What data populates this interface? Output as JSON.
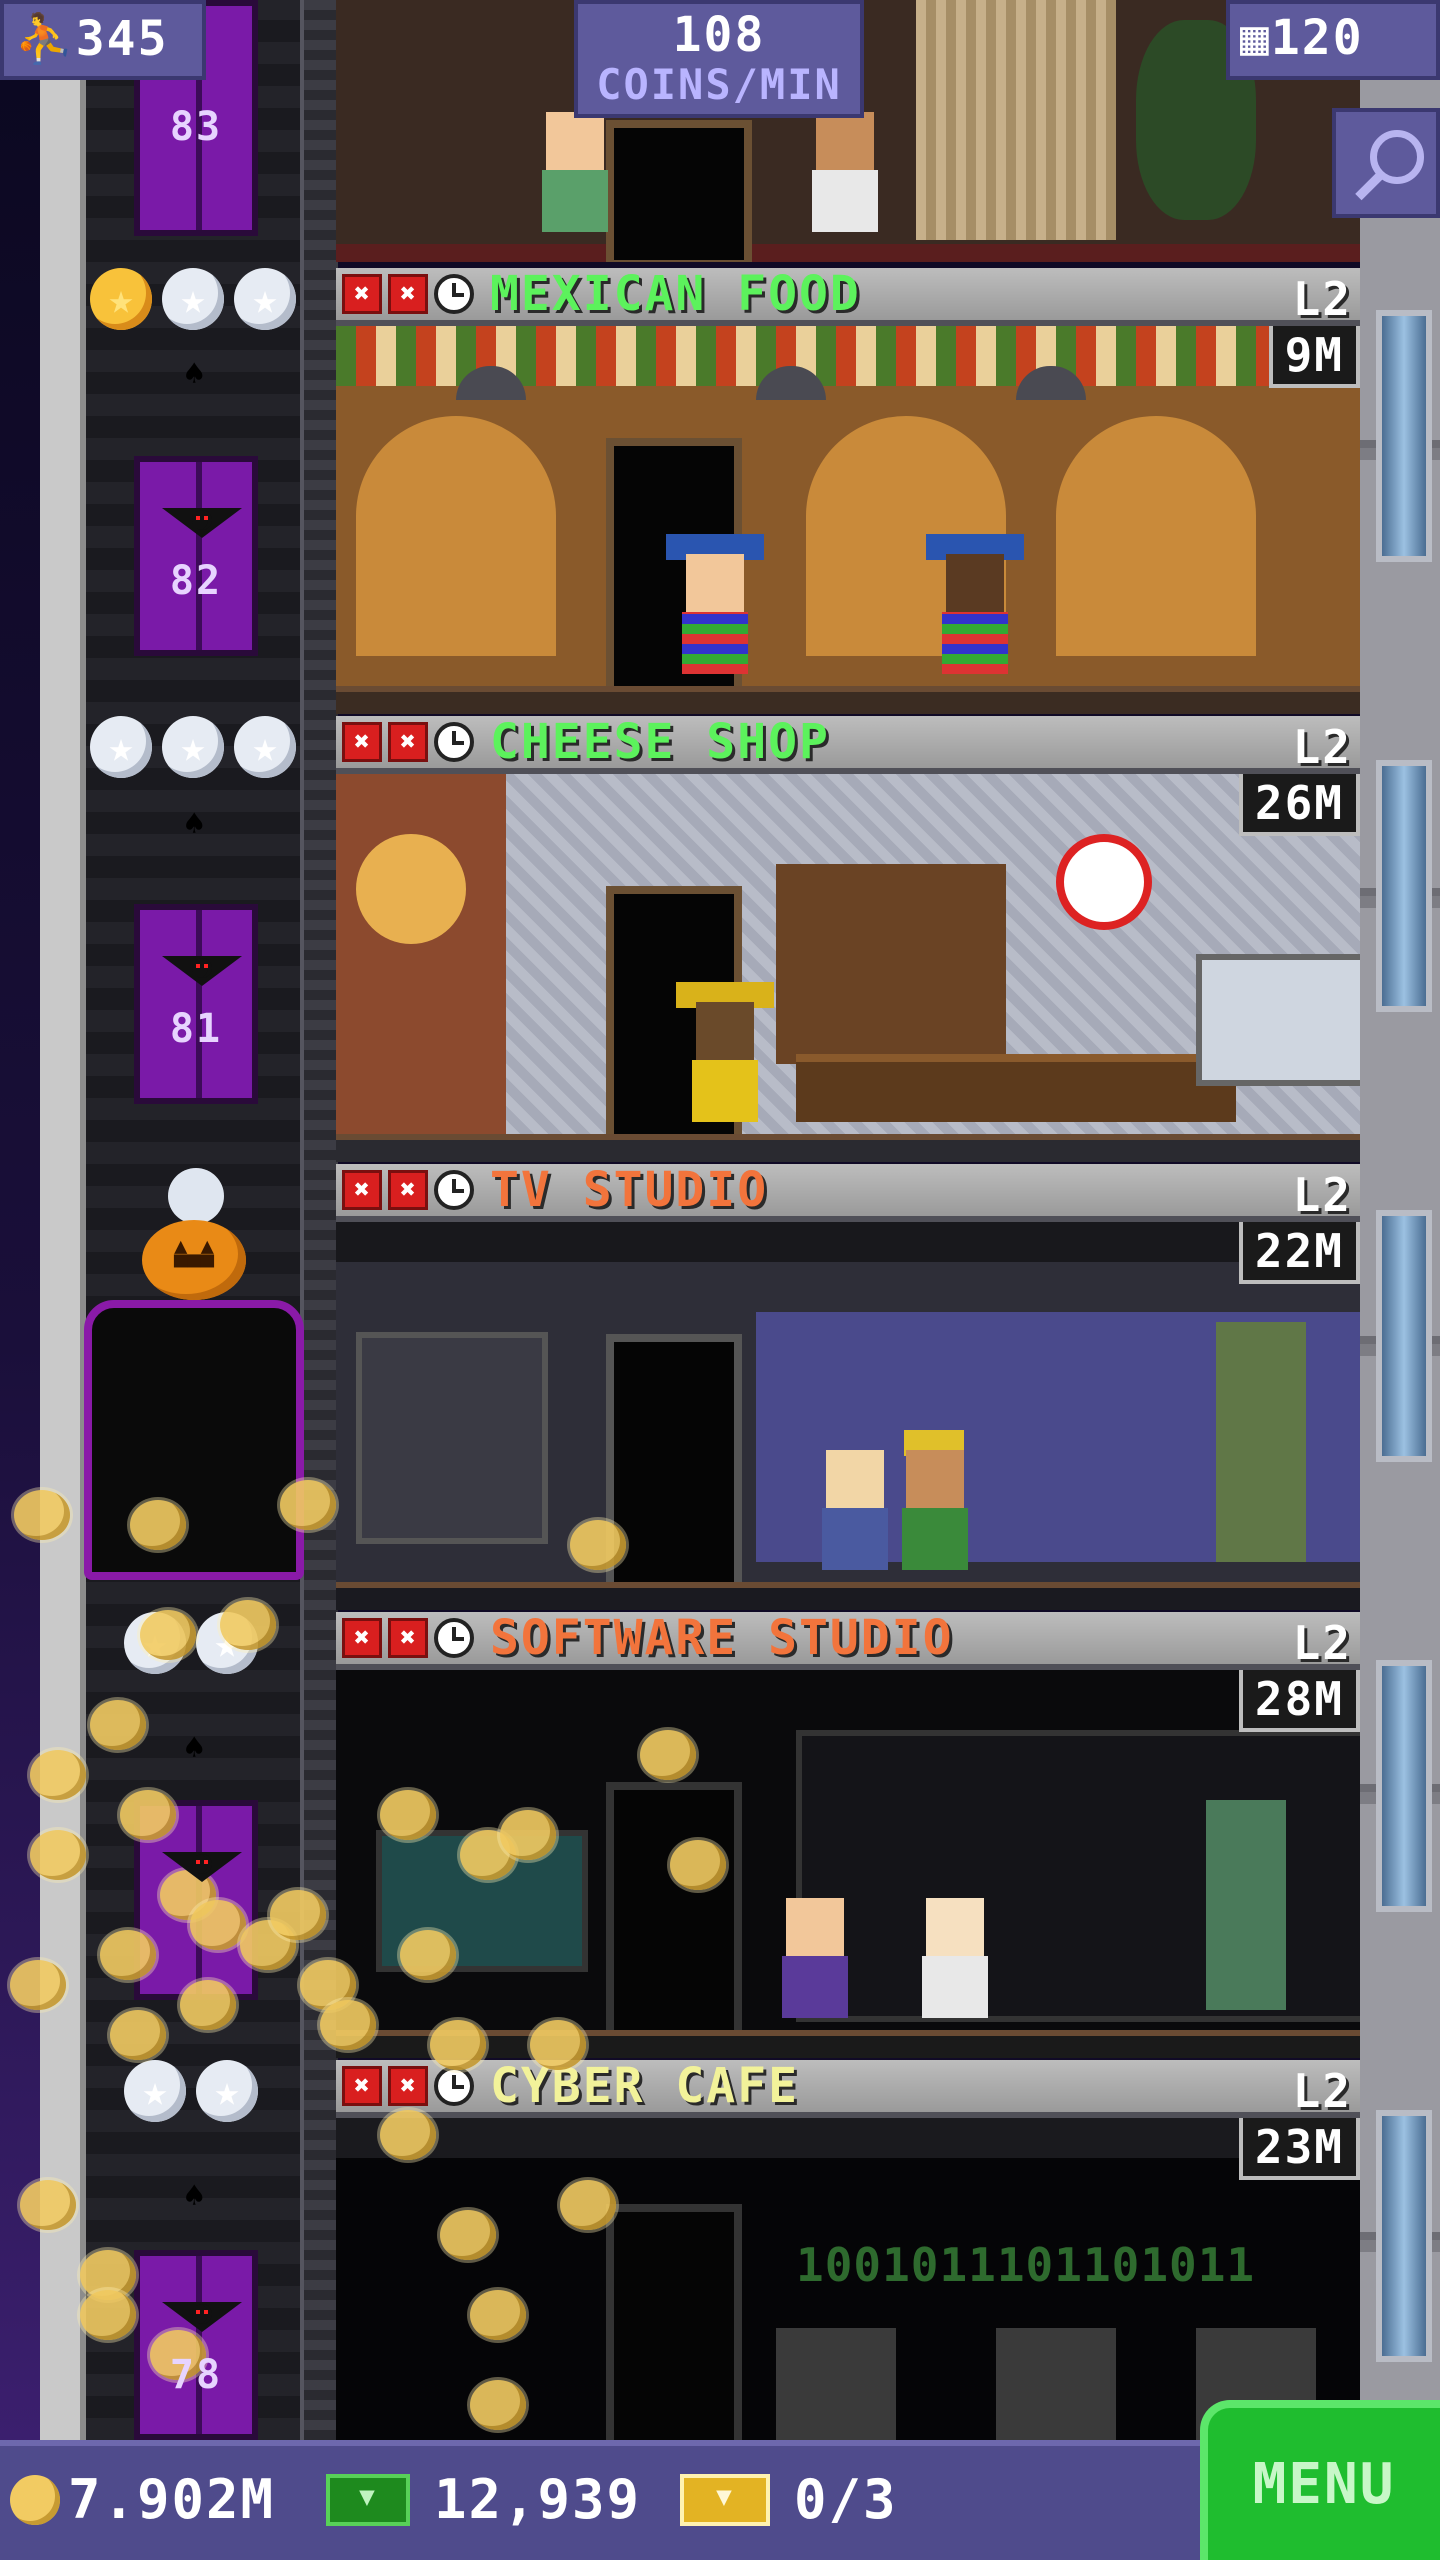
{
  "top_bar": {
    "population": "345",
    "population_icon": "person-icon",
    "rate_value": "108",
    "rate_label": "COINS/MIN",
    "floors": "120",
    "floors_icon": "building-icon",
    "zoom_icon": "zoom-out-icon"
  },
  "elevator": {
    "floor_numbers": [
      "83",
      "82",
      "81",
      "78"
    ]
  },
  "floors": [
    {
      "name": "MEXICAN FOOD",
      "level": "L2",
      "income": "9M",
      "name_color": "#5cf25c",
      "stars": "1 gold, 2 silver"
    },
    {
      "name": "CHEESE SHOP",
      "level": "L2",
      "income": "26M",
      "name_color": "#5cf25c",
      "stars": "3 silver"
    },
    {
      "name": "TV STUDIO",
      "level": "L2",
      "income": "22M",
      "name_color": "#f2743c",
      "stars": "0"
    },
    {
      "name": "SOFTWARE STUDIO",
      "level": "L2",
      "income": "28M",
      "name_color": "#f2743c",
      "stars": "2 silver"
    },
    {
      "name": "CYBER CAFE",
      "level": "L2",
      "income": "23M",
      "name_color": "#f2f29a",
      "stars": "2 silver"
    }
  ],
  "cyber_cafe_screen_text": "1001011101101011",
  "bottom_bar": {
    "coins": "7.902M",
    "bux": "12,939",
    "tickets": "0/3",
    "menu_label": "MENU"
  }
}
